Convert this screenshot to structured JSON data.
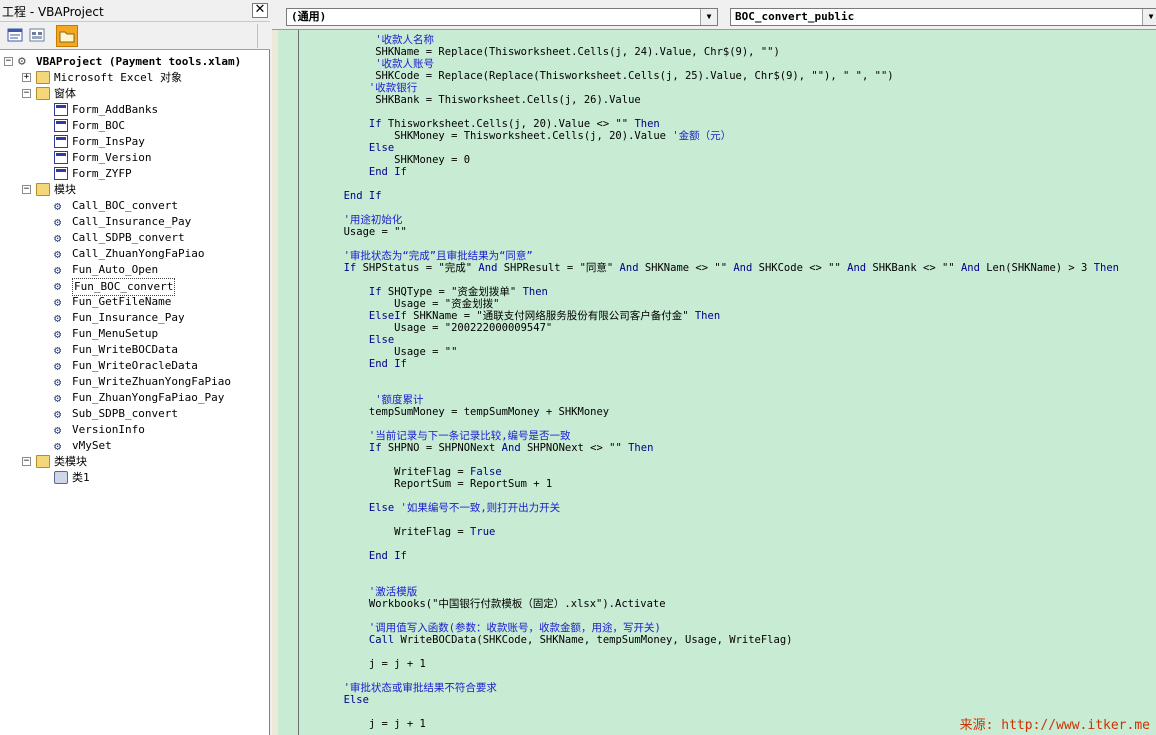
{
  "project_explorer": {
    "title": "工程 - VBAProject",
    "close_label": "✕",
    "tree": {
      "project": "VBAProject (Payment tools.xlam)",
      "excel_objects": "Microsoft Excel 对象",
      "forms_folder": "窗体",
      "forms": [
        "Form_AddBanks",
        "Form_BOC",
        "Form_InsPay",
        "Form_Version",
        "Form_ZYFP"
      ],
      "modules_folder": "模块",
      "modules": [
        "Call_BOC_convert",
        "Call_Insurance_Pay",
        "Call_SDPB_convert",
        "Call_ZhuanYongFaPiao",
        "Fun_Auto_Open",
        "Fun_BOC_convert",
        "Fun_GetFileName",
        "Fun_Insurance_Pay",
        "Fun_MenuSetup",
        "Fun_WriteBOCData",
        "Fun_WriteOracleData",
        "Fun_WriteZhuanYongFaPiao",
        "Fun_ZhuanYongFaPiao_Pay",
        "Sub_SDPB_convert",
        "VersionInfo",
        "vMySet"
      ],
      "selected_module": "Fun_BOC_convert",
      "class_folder": "类模块",
      "classes": [
        "类1"
      ]
    }
  },
  "code_window": {
    "object_combo": "(通用)",
    "procedure_combo": "BOC_convert_public",
    "lines": [
      [
        {
          "t": "          ",
          "c": ""
        },
        {
          "t": "'收款人名称",
          "c": "cm"
        }
      ],
      [
        {
          "t": "          SHKName = Replace(Thisworksheet.Cells(j, 24).Value, Chr$(9), \"\")",
          "c": ""
        }
      ],
      [
        {
          "t": "          ",
          "c": ""
        },
        {
          "t": "'收款人账号",
          "c": "cm"
        }
      ],
      [
        {
          "t": "          SHKCode = Replace(Replace(Thisworksheet.Cells(j, 25).Value, Chr$(9), \"\"), \" \", \"\")",
          "c": ""
        }
      ],
      [
        {
          "t": "         ",
          "c": ""
        },
        {
          "t": "'收款银行",
          "c": "cm"
        }
      ],
      [
        {
          "t": "          SHKBank = Thisworksheet.Cells(j, 26).Value",
          "c": ""
        }
      ],
      [
        {
          "t": "",
          "c": ""
        }
      ],
      [
        {
          "t": "         ",
          "c": ""
        },
        {
          "t": "If",
          "c": "kw"
        },
        {
          "t": " Thisworksheet.Cells(j, 20).Value <> \"\" ",
          "c": ""
        },
        {
          "t": "Then",
          "c": "kw"
        }
      ],
      [
        {
          "t": "             SHKMoney = Thisworksheet.Cells(j, 20).Value ",
          "c": ""
        },
        {
          "t": "'金额（元）",
          "c": "cm"
        }
      ],
      [
        {
          "t": "         ",
          "c": ""
        },
        {
          "t": "Else",
          "c": "kw"
        }
      ],
      [
        {
          "t": "             SHKMoney = 0",
          "c": ""
        }
      ],
      [
        {
          "t": "         ",
          "c": ""
        },
        {
          "t": "End If",
          "c": "kw"
        }
      ],
      [
        {
          "t": "",
          "c": ""
        }
      ],
      [
        {
          "t": "     ",
          "c": ""
        },
        {
          "t": "End If",
          "c": "kw"
        }
      ],
      [
        {
          "t": "",
          "c": ""
        }
      ],
      [
        {
          "t": "     ",
          "c": ""
        },
        {
          "t": "'用途初始化",
          "c": "cm"
        }
      ],
      [
        {
          "t": "     Usage = \"\"",
          "c": ""
        }
      ],
      [
        {
          "t": "",
          "c": ""
        }
      ],
      [
        {
          "t": "     ",
          "c": ""
        },
        {
          "t": "'审批状态为“完成”且审批结果为“同意”",
          "c": "cm"
        }
      ],
      [
        {
          "t": "     ",
          "c": ""
        },
        {
          "t": "If",
          "c": "kw"
        },
        {
          "t": " SHPStatus = \"完成\" ",
          "c": ""
        },
        {
          "t": "And",
          "c": "kw"
        },
        {
          "t": " SHPResult = \"同意\" ",
          "c": ""
        },
        {
          "t": "And",
          "c": "kw"
        },
        {
          "t": " SHKName <> \"\" ",
          "c": ""
        },
        {
          "t": "And",
          "c": "kw"
        },
        {
          "t": " SHKCode <> \"\" ",
          "c": ""
        },
        {
          "t": "And",
          "c": "kw"
        },
        {
          "t": " SHKBank <> \"\" ",
          "c": ""
        },
        {
          "t": "And",
          "c": "kw"
        },
        {
          "t": " Len(SHKName) > 3 ",
          "c": ""
        },
        {
          "t": "Then",
          "c": "kw"
        }
      ],
      [
        {
          "t": "",
          "c": ""
        }
      ],
      [
        {
          "t": "         ",
          "c": ""
        },
        {
          "t": "If",
          "c": "kw"
        },
        {
          "t": " SHQType = \"资金划拨单\" ",
          "c": ""
        },
        {
          "t": "Then",
          "c": "kw"
        }
      ],
      [
        {
          "t": "             Usage = \"资金划拨\"",
          "c": ""
        }
      ],
      [
        {
          "t": "         ",
          "c": ""
        },
        {
          "t": "ElseIf",
          "c": "kw"
        },
        {
          "t": " SHKName = \"通联支付网络服务股份有限公司客户备付金\" ",
          "c": ""
        },
        {
          "t": "Then",
          "c": "kw"
        }
      ],
      [
        {
          "t": "             Usage = \"200222000009547\"",
          "c": ""
        }
      ],
      [
        {
          "t": "         ",
          "c": ""
        },
        {
          "t": "Else",
          "c": "kw"
        }
      ],
      [
        {
          "t": "             Usage = \"\"",
          "c": ""
        }
      ],
      [
        {
          "t": "         ",
          "c": ""
        },
        {
          "t": "End If",
          "c": "kw"
        }
      ],
      [
        {
          "t": "",
          "c": ""
        }
      ],
      [
        {
          "t": "",
          "c": ""
        }
      ],
      [
        {
          "t": "          ",
          "c": ""
        },
        {
          "t": "'额度累计",
          "c": "cm"
        }
      ],
      [
        {
          "t": "         tempSumMoney = tempSumMoney + SHKMoney",
          "c": ""
        }
      ],
      [
        {
          "t": "",
          "c": ""
        }
      ],
      [
        {
          "t": "         ",
          "c": ""
        },
        {
          "t": "'当前记录与下一条记录比较,编号是否一致",
          "c": "cm"
        }
      ],
      [
        {
          "t": "         ",
          "c": ""
        },
        {
          "t": "If",
          "c": "kw"
        },
        {
          "t": " SHPNO = SHPNONext ",
          "c": ""
        },
        {
          "t": "And",
          "c": "kw"
        },
        {
          "t": " SHPNONext <> \"\" ",
          "c": ""
        },
        {
          "t": "Then",
          "c": "kw"
        }
      ],
      [
        {
          "t": "",
          "c": ""
        }
      ],
      [
        {
          "t": "             WriteFlag = ",
          "c": ""
        },
        {
          "t": "False",
          "c": "kw"
        }
      ],
      [
        {
          "t": "             ReportSum = ReportSum + 1",
          "c": ""
        }
      ],
      [
        {
          "t": "",
          "c": ""
        }
      ],
      [
        {
          "t": "         ",
          "c": ""
        },
        {
          "t": "Else",
          "c": "kw"
        },
        {
          "t": " ",
          "c": ""
        },
        {
          "t": "'如果编号不一致,则打开出力开关",
          "c": "cm"
        }
      ],
      [
        {
          "t": "",
          "c": ""
        }
      ],
      [
        {
          "t": "             WriteFlag = ",
          "c": ""
        },
        {
          "t": "True",
          "c": "kw"
        }
      ],
      [
        {
          "t": "",
          "c": ""
        }
      ],
      [
        {
          "t": "         ",
          "c": ""
        },
        {
          "t": "End If",
          "c": "kw"
        }
      ],
      [
        {
          "t": "",
          "c": ""
        }
      ],
      [
        {
          "t": "",
          "c": ""
        }
      ],
      [
        {
          "t": "         ",
          "c": ""
        },
        {
          "t": "'激活模版",
          "c": "cm"
        }
      ],
      [
        {
          "t": "         Workbooks(\"中国银行付款模板（固定）.xlsx\").Activate",
          "c": ""
        }
      ],
      [
        {
          "t": "",
          "c": ""
        }
      ],
      [
        {
          "t": "         ",
          "c": ""
        },
        {
          "t": "'调用值写入函数(参数：收款账号，收款金额，用途，写开关)",
          "c": "cm"
        }
      ],
      [
        {
          "t": "         ",
          "c": ""
        },
        {
          "t": "Call",
          "c": "kw"
        },
        {
          "t": " WriteBOCData(SHKCode, SHKName, tempSumMoney, Usage, WriteFlag)",
          "c": ""
        }
      ],
      [
        {
          "t": "",
          "c": ""
        }
      ],
      [
        {
          "t": "         j = j + 1",
          "c": ""
        }
      ],
      [
        {
          "t": "",
          "c": ""
        }
      ],
      [
        {
          "t": "     ",
          "c": ""
        },
        {
          "t": "'审批状态或审批结果不符合要求",
          "c": "cm"
        }
      ],
      [
        {
          "t": "     ",
          "c": ""
        },
        {
          "t": "Else",
          "c": "kw"
        }
      ],
      [
        {
          "t": "",
          "c": ""
        }
      ],
      [
        {
          "t": "         j = j + 1",
          "c": ""
        }
      ]
    ],
    "watermark": "来源: http://www.itker.me"
  },
  "colors": {
    "code_background": "#c7ebd3",
    "keyword": "#00008b",
    "comment": "#1c1cd0"
  }
}
